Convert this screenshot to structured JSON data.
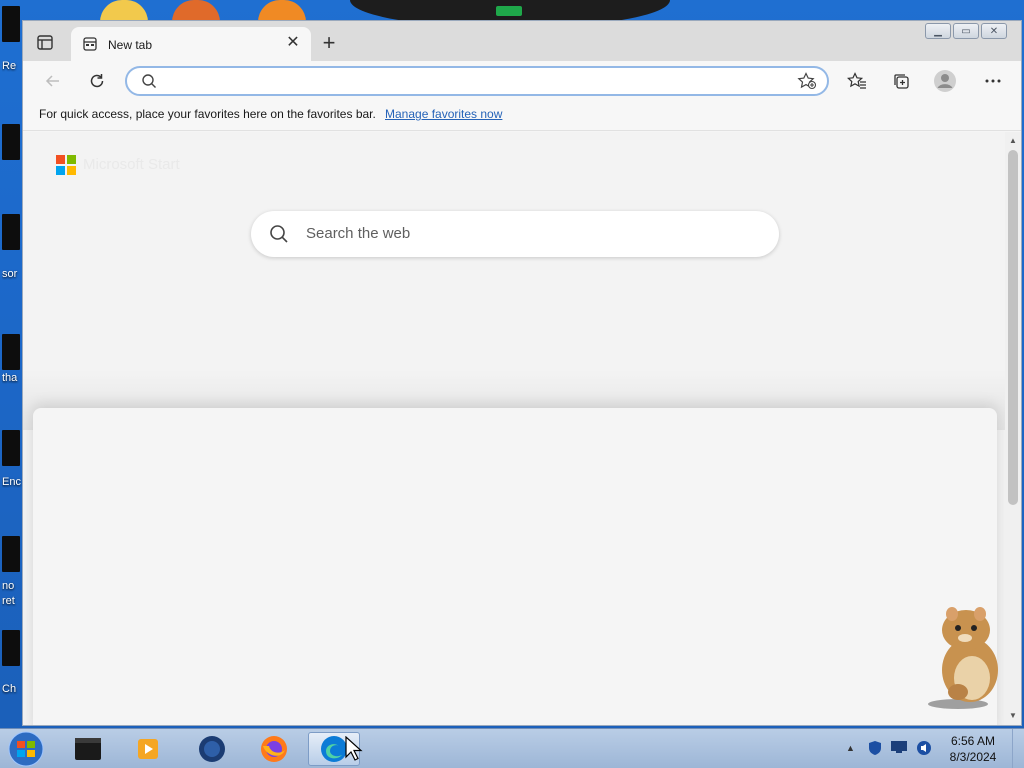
{
  "desktop": {
    "labels": [
      "Re",
      "sor",
      "tha",
      "Enc",
      "no",
      "ret",
      "Ch"
    ]
  },
  "browser": {
    "tab": {
      "title": "New tab"
    },
    "address": {
      "value": "",
      "placeholder": ""
    },
    "favorites_bar": {
      "message": "For quick access, place your favorites here on the favorites bar.",
      "link": "Manage favorites now"
    },
    "newtab": {
      "brand": "Microsoft Start",
      "search_placeholder": "Search the web"
    }
  },
  "taskbar": {
    "apps": [
      "cmd-icon",
      "media-player-icon",
      "thunderbird-icon",
      "firefox-icon",
      "edge-icon"
    ],
    "clock": {
      "time": "6:56 AM",
      "date": "8/3/2024"
    }
  },
  "colors": {
    "desktop_bg": "#1f6fd1",
    "link": "#2563b8",
    "address_focus": "#93b8e6",
    "ms_red": "#f25022",
    "ms_green": "#7fba00",
    "ms_blue": "#00a4ef",
    "ms_yellow": "#ffb900"
  }
}
